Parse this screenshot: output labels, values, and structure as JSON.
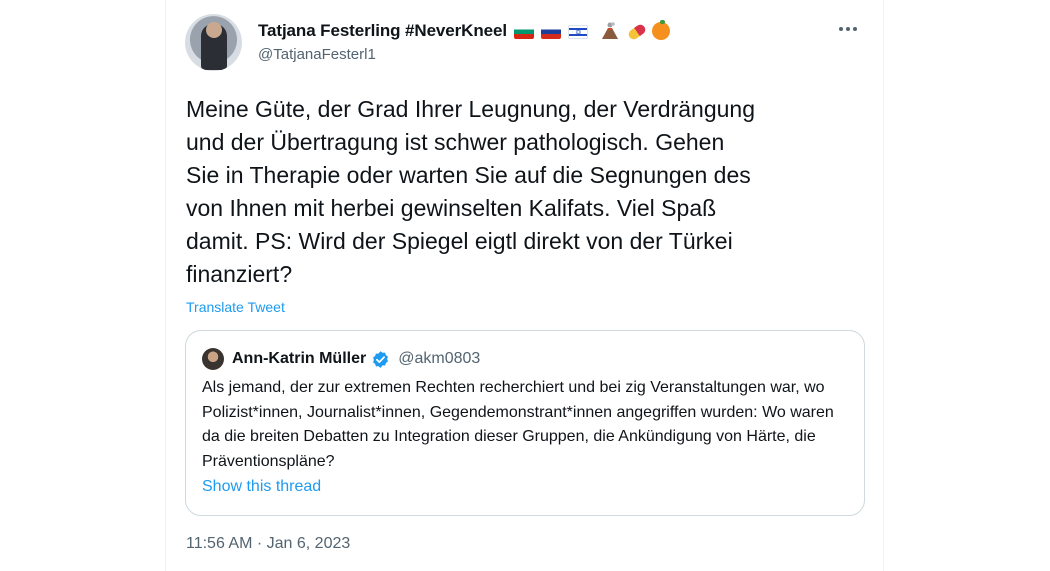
{
  "author": {
    "display_name": "Tatjana Festerling #NeverKneel",
    "handle": "@TatjanaFesterl1",
    "name_flags": [
      "flag-bulgaria-icon",
      "flag-russia-icon",
      "flag-israel-icon"
    ],
    "name_emojis": [
      "volcano-icon",
      "pill-icon",
      "orange-icon"
    ]
  },
  "tweet": {
    "text": "Meine Güte, der Grad Ihrer Leugnung, der Verdrängung\nund der Übertragung ist schwer pathologisch. Gehen\nSie in Therapie oder warten Sie auf die Segnungen des\nvon Ihnen mit herbei gewinselten Kalifats. Viel Spaß\ndamit. PS: Wird der Spiegel eigtl direkt von der Türkei\nfinanziert?",
    "translate_label": "Translate Tweet",
    "timestamp": "11:56 AM · Jan 6, 2023"
  },
  "quoted_tweet": {
    "display_name": "Ann-Katrin Müller",
    "handle": "@akm0803",
    "verified": true,
    "text": "Als jemand, der zur extremen Rechten recherchiert und bei zig Veranstaltungen war, wo Polizist*innen, Journalist*innen, Gegendemonstrant*innen angegriffen wurden: Wo waren da die breiten Debatten zu Integration dieser Gruppen, die Ankündigung von Härte, die Präventionspläne?",
    "show_thread_label": "Show this thread"
  },
  "colors": {
    "link": "#1d9bf0",
    "secondary_text": "#536471",
    "primary_text": "#0f1419",
    "border": "#cfd9de"
  }
}
